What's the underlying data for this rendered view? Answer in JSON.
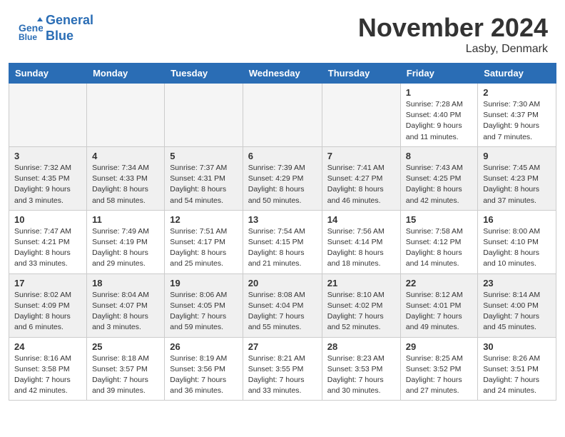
{
  "header": {
    "logo_line1": "General",
    "logo_line2": "Blue",
    "month": "November 2024",
    "location": "Lasby, Denmark"
  },
  "weekdays": [
    "Sunday",
    "Monday",
    "Tuesday",
    "Wednesday",
    "Thursday",
    "Friday",
    "Saturday"
  ],
  "rows": [
    [
      {
        "day": "",
        "info": ""
      },
      {
        "day": "",
        "info": ""
      },
      {
        "day": "",
        "info": ""
      },
      {
        "day": "",
        "info": ""
      },
      {
        "day": "",
        "info": ""
      },
      {
        "day": "1",
        "info": "Sunrise: 7:28 AM\nSunset: 4:40 PM\nDaylight: 9 hours and 11 minutes."
      },
      {
        "day": "2",
        "info": "Sunrise: 7:30 AM\nSunset: 4:37 PM\nDaylight: 9 hours and 7 minutes."
      }
    ],
    [
      {
        "day": "3",
        "info": "Sunrise: 7:32 AM\nSunset: 4:35 PM\nDaylight: 9 hours and 3 minutes."
      },
      {
        "day": "4",
        "info": "Sunrise: 7:34 AM\nSunset: 4:33 PM\nDaylight: 8 hours and 58 minutes."
      },
      {
        "day": "5",
        "info": "Sunrise: 7:37 AM\nSunset: 4:31 PM\nDaylight: 8 hours and 54 minutes."
      },
      {
        "day": "6",
        "info": "Sunrise: 7:39 AM\nSunset: 4:29 PM\nDaylight: 8 hours and 50 minutes."
      },
      {
        "day": "7",
        "info": "Sunrise: 7:41 AM\nSunset: 4:27 PM\nDaylight: 8 hours and 46 minutes."
      },
      {
        "day": "8",
        "info": "Sunrise: 7:43 AM\nSunset: 4:25 PM\nDaylight: 8 hours and 42 minutes."
      },
      {
        "day": "9",
        "info": "Sunrise: 7:45 AM\nSunset: 4:23 PM\nDaylight: 8 hours and 37 minutes."
      }
    ],
    [
      {
        "day": "10",
        "info": "Sunrise: 7:47 AM\nSunset: 4:21 PM\nDaylight: 8 hours and 33 minutes."
      },
      {
        "day": "11",
        "info": "Sunrise: 7:49 AM\nSunset: 4:19 PM\nDaylight: 8 hours and 29 minutes."
      },
      {
        "day": "12",
        "info": "Sunrise: 7:51 AM\nSunset: 4:17 PM\nDaylight: 8 hours and 25 minutes."
      },
      {
        "day": "13",
        "info": "Sunrise: 7:54 AM\nSunset: 4:15 PM\nDaylight: 8 hours and 21 minutes."
      },
      {
        "day": "14",
        "info": "Sunrise: 7:56 AM\nSunset: 4:14 PM\nDaylight: 8 hours and 18 minutes."
      },
      {
        "day": "15",
        "info": "Sunrise: 7:58 AM\nSunset: 4:12 PM\nDaylight: 8 hours and 14 minutes."
      },
      {
        "day": "16",
        "info": "Sunrise: 8:00 AM\nSunset: 4:10 PM\nDaylight: 8 hours and 10 minutes."
      }
    ],
    [
      {
        "day": "17",
        "info": "Sunrise: 8:02 AM\nSunset: 4:09 PM\nDaylight: 8 hours and 6 minutes."
      },
      {
        "day": "18",
        "info": "Sunrise: 8:04 AM\nSunset: 4:07 PM\nDaylight: 8 hours and 3 minutes."
      },
      {
        "day": "19",
        "info": "Sunrise: 8:06 AM\nSunset: 4:05 PM\nDaylight: 7 hours and 59 minutes."
      },
      {
        "day": "20",
        "info": "Sunrise: 8:08 AM\nSunset: 4:04 PM\nDaylight: 7 hours and 55 minutes."
      },
      {
        "day": "21",
        "info": "Sunrise: 8:10 AM\nSunset: 4:02 PM\nDaylight: 7 hours and 52 minutes."
      },
      {
        "day": "22",
        "info": "Sunrise: 8:12 AM\nSunset: 4:01 PM\nDaylight: 7 hours and 49 minutes."
      },
      {
        "day": "23",
        "info": "Sunrise: 8:14 AM\nSunset: 4:00 PM\nDaylight: 7 hours and 45 minutes."
      }
    ],
    [
      {
        "day": "24",
        "info": "Sunrise: 8:16 AM\nSunset: 3:58 PM\nDaylight: 7 hours and 42 minutes."
      },
      {
        "day": "25",
        "info": "Sunrise: 8:18 AM\nSunset: 3:57 PM\nDaylight: 7 hours and 39 minutes."
      },
      {
        "day": "26",
        "info": "Sunrise: 8:19 AM\nSunset: 3:56 PM\nDaylight: 7 hours and 36 minutes."
      },
      {
        "day": "27",
        "info": "Sunrise: 8:21 AM\nSunset: 3:55 PM\nDaylight: 7 hours and 33 minutes."
      },
      {
        "day": "28",
        "info": "Sunrise: 8:23 AM\nSunset: 3:53 PM\nDaylight: 7 hours and 30 minutes."
      },
      {
        "day": "29",
        "info": "Sunrise: 8:25 AM\nSunset: 3:52 PM\nDaylight: 7 hours and 27 minutes."
      },
      {
        "day": "30",
        "info": "Sunrise: 8:26 AM\nSunset: 3:51 PM\nDaylight: 7 hours and 24 minutes."
      }
    ]
  ],
  "alt_rows": [
    1,
    3
  ]
}
